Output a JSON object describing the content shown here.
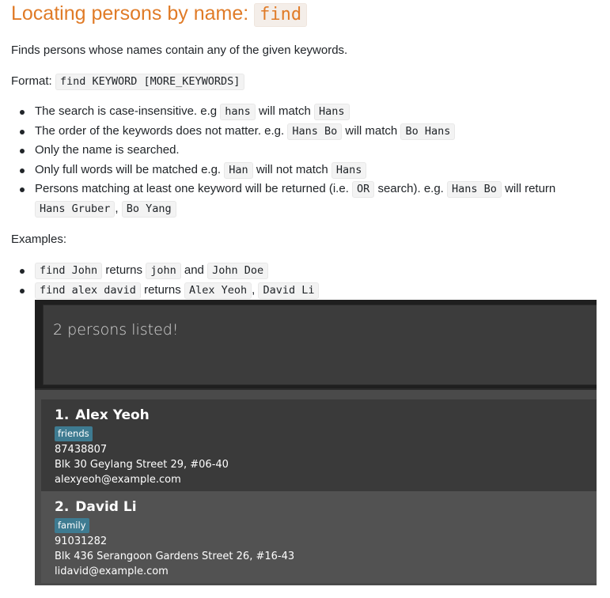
{
  "heading": {
    "text": "Locating persons by name: ",
    "code": "find"
  },
  "intro": "Finds persons whose names contain any of the given keywords.",
  "format": {
    "label": "Format: ",
    "code": "find KEYWORD [MORE_KEYWORDS]"
  },
  "rules": {
    "r1": {
      "t1": "The search is case-insensitive. e.g ",
      "c1": "hans",
      "t2": " will match ",
      "c2": "Hans"
    },
    "r2": {
      "t1": "The order of the keywords does not matter. e.g. ",
      "c1": "Hans Bo",
      "t2": " will match ",
      "c2": "Bo Hans"
    },
    "r3": {
      "t1": "Only the name is searched."
    },
    "r4": {
      "t1": "Only full words will be matched e.g. ",
      "c1": "Han",
      "t2": " will not match ",
      "c2": "Hans"
    },
    "r5": {
      "t1": "Persons matching at least one keyword will be returned (i.e. ",
      "c1": "OR",
      "t2": " search). e.g. ",
      "c2": "Hans Bo",
      "t3": " will return",
      "c3": "Hans Gruber",
      "t4": ", ",
      "c4": "Bo Yang"
    }
  },
  "examples_label": "Examples:",
  "examples": {
    "e1": {
      "c1": "find John",
      "t1": " returns ",
      "c2": "john",
      "t2": " and ",
      "c3": "John Doe"
    },
    "e2": {
      "c1": "find alex david",
      "t1": " returns ",
      "c2": "Alex Yeoh",
      "t2": ", ",
      "c3": "David Li"
    }
  },
  "app": {
    "result": "2 persons listed!",
    "persons": [
      {
        "index": "1.",
        "name": "Alex Yeoh",
        "tag": "friends",
        "phone": "87438807",
        "address": "Blk 30 Geylang Street 29, #06-40",
        "email": "alexyeoh@example.com"
      },
      {
        "index": "2.",
        "name": "David Li",
        "tag": "family",
        "phone": "91031282",
        "address": "Blk 436 Serangoon Gardens Street 26, #16-43",
        "email": "lidavid@example.com"
      }
    ],
    "colors": {
      "tag": "#3e7b91",
      "card_dark": "#3a3a3a",
      "card_light": "#525252"
    }
  }
}
